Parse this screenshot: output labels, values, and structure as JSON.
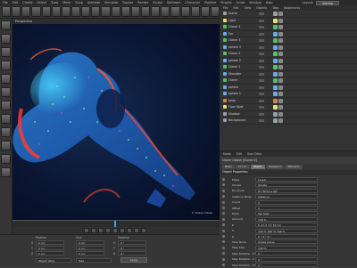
{
  "menu": {
    "items": [
      "File",
      "Edit",
      "Create",
      "Select",
      "Tools",
      "Mesh",
      "Snap",
      "Animate",
      "Simulate",
      "Tracker",
      "Render",
      "Sculpt",
      "MoGraph",
      "Character",
      "Pipeline",
      "Plugins",
      "Script",
      "Window",
      "Help"
    ],
    "layout_label": "Layout:",
    "layout_value": "Startup"
  },
  "viewport": {
    "label": "Perspective",
    "credit": "© Nidiaa Vitalis"
  },
  "coords": {
    "col_position": "Position",
    "col_size": "Size",
    "col_rotation": "Rotation",
    "rows": [
      {
        "axis": "X",
        "pos": "0 cm",
        "size": "0 cm",
        "rot_axis": "H",
        "rot": "0 °"
      },
      {
        "axis": "Y",
        "pos": "0 cm",
        "size": "0 cm",
        "rot_axis": "P",
        "rot": "0 °"
      },
      {
        "axis": "Z",
        "pos": "0 cm",
        "size": "0 cm",
        "rot_axis": "B",
        "rot": "0 °"
      }
    ],
    "mode": "Object (Rel)",
    "size_mode": "Size",
    "apply": "Apply"
  },
  "object_manager": {
    "menu": [
      "File",
      "Edit",
      "View",
      "Objects",
      "Tags",
      "Bookmarks"
    ],
    "objects": [
      {
        "name": "Scene",
        "color": "#9aa0aa"
      },
      {
        "name": "Light",
        "color": "#e2e07a"
      },
      {
        "name": "Cloner 4",
        "color": "#56c06a"
      },
      {
        "name": "Ear",
        "color": "#6fa8e8"
      },
      {
        "name": "Cloner 3",
        "color": "#56c06a"
      },
      {
        "name": "sphere 3",
        "color": "#6fa8e8"
      },
      {
        "name": "Cloner 2",
        "color": "#56c06a"
      },
      {
        "name": "sphere 2",
        "color": "#6fa8e8"
      },
      {
        "name": "Cloner 1",
        "color": "#56c06a"
      },
      {
        "name": "Shoulder",
        "color": "#6fa8e8"
      },
      {
        "name": "Cloner",
        "color": "#56c06a"
      },
      {
        "name": "sphere",
        "color": "#6fa8e8"
      },
      {
        "name": "sphere 1",
        "color": "#6fa8e8"
      },
      {
        "name": "body",
        "color": "#c98a5a"
      },
      {
        "name": "Floor Spot",
        "color": "#e2e07a"
      },
      {
        "name": "Shadow",
        "color": "#9aa0aa"
      },
      {
        "name": "Background",
        "color": "#9aa0aa"
      }
    ]
  },
  "attributes": {
    "menu": [
      "Mode",
      "Edit",
      "User Data"
    ],
    "title": "Cloner Object [Cloner 4]",
    "tabs": [
      "Basic",
      "Coord.",
      "Object",
      "Transform",
      "Effectors"
    ],
    "active_tab": "Object",
    "section": "Object Properties",
    "props": [
      {
        "label": "Mode",
        "value": "Linear"
      },
      {
        "label": "Clones",
        "value": "Iterate"
      },
      {
        "label": "Fix Clone",
        "value": "Fix Texture  Off"
      },
      {
        "label": "Instance Mode",
        "value": "Instance"
      },
      {
        "label": "Count",
        "value": "3"
      },
      {
        "label": "Offset",
        "value": "0"
      },
      {
        "label": "Mode",
        "value": "Per Step"
      },
      {
        "label": "Amount",
        "value": "100 %"
      },
      {
        "label": "P",
        "value": "0 cm   0 cm   50 cm"
      },
      {
        "label": "S",
        "value": "100 %   100 %   100 %"
      },
      {
        "label": "R",
        "value": "0 °   0 °   0 °"
      },
      {
        "label": "Step Mode",
        "value": "Single Value"
      },
      {
        "label": "Step Size",
        "value": "100 %"
      },
      {
        "label": "Step Rotation . H",
        "value": "0 °"
      },
      {
        "label": "Step Rotation . P",
        "value": "0 °"
      },
      {
        "label": "Step Rotation . B",
        "value": "0 °"
      }
    ]
  }
}
